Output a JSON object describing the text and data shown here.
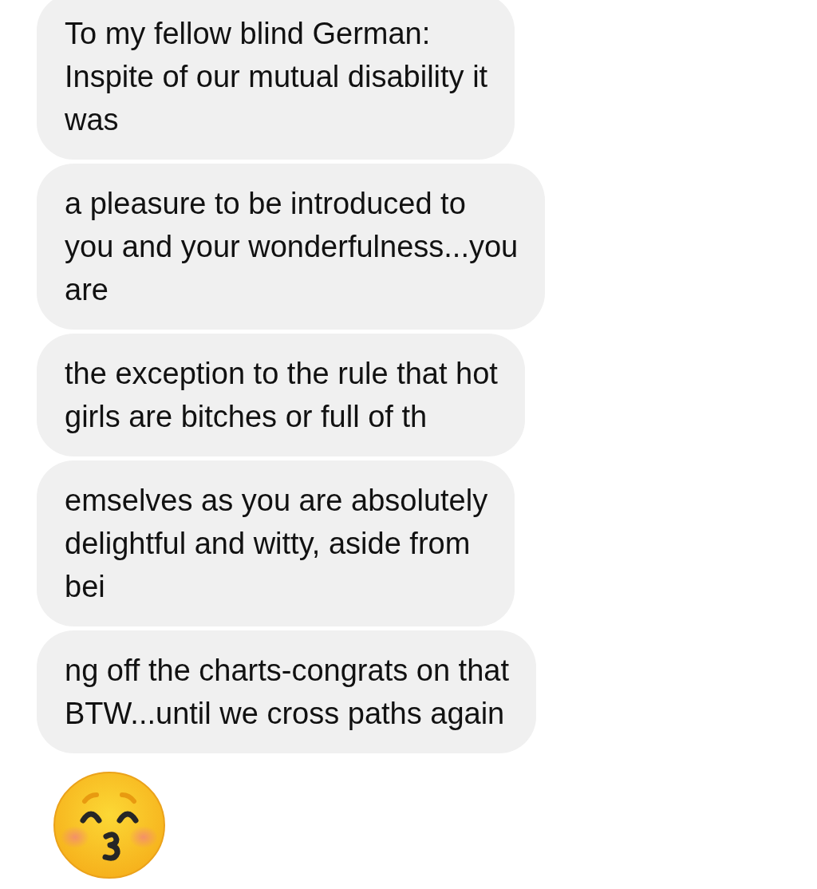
{
  "messages": [
    {
      "lines": [
        "To my fellow blind German:",
        "Inspite of our mutual disability it",
        "was"
      ]
    },
    {
      "lines": [
        "a pleasure to be introduced to",
        "you and your wonderfulness...you",
        "are"
      ]
    },
    {
      "lines": [
        "the exception to the rule that hot",
        "girls are bitches or full of th"
      ]
    },
    {
      "lines": [
        "emselves as you are absolutely",
        "delightful and witty, aside from",
        "bei"
      ]
    },
    {
      "lines": [
        "ng off the charts-congrats on that",
        "BTW...until we cross paths again"
      ]
    }
  ]
}
